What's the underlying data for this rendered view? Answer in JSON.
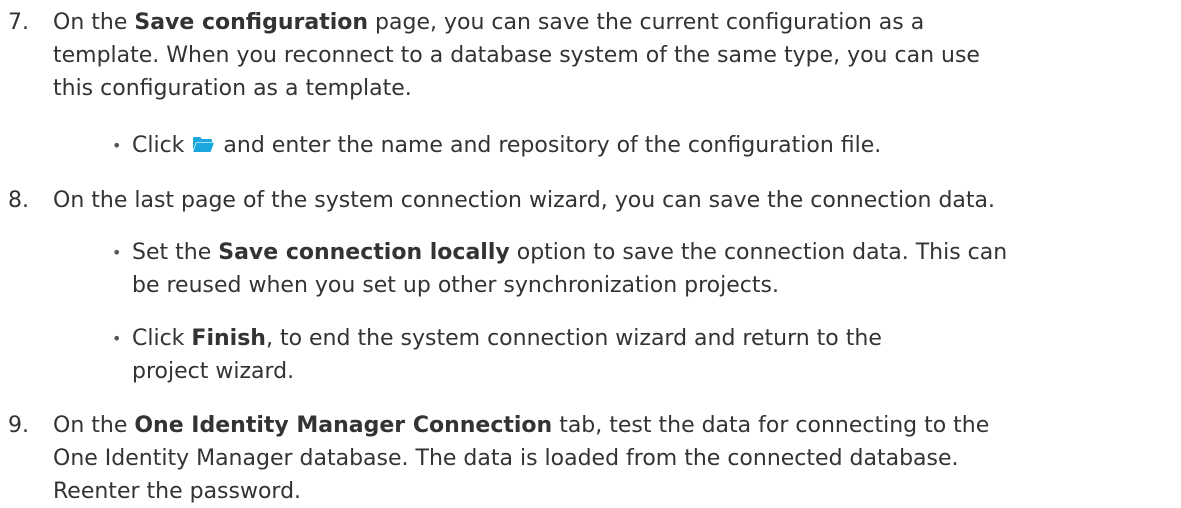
{
  "steps": {
    "s7": {
      "number": "7.",
      "pre": "On the ",
      "bold": "Save configuration",
      "post": " page, you can save the current configuration as a",
      "line2": "template. When you reconnect to a database system of the same type, you can use",
      "line3": "this configuration as a template.",
      "bullet": {
        "pre": "Click ",
        "icon": "folder-open-icon",
        "post": " and enter the name and repository of the configuration file."
      }
    },
    "s8": {
      "number": "8.",
      "line1": "On the last page of the system connection wizard, you can save the connection data.",
      "bullet1": {
        "pre": "Set the ",
        "bold": "Save connection locally",
        "post": " option to save the connection data. This can",
        "line2": "be reused when you set up other synchronization projects."
      },
      "bullet2": {
        "pre": "Click ",
        "bold": "Finish",
        "post": ", to end the system connection wizard and return to the",
        "line2": "project wizard."
      }
    },
    "s9": {
      "number": "9.",
      "pre": "On the ",
      "bold": "One Identity Manager Connection",
      "post": " tab, test the data for connecting to the",
      "line2": "One Identity Manager database. The data is loaded from the connected database.",
      "line3": "Reenter the password."
    }
  },
  "colors": {
    "text": "#333333",
    "folder_icon": "#1aa7e0"
  }
}
